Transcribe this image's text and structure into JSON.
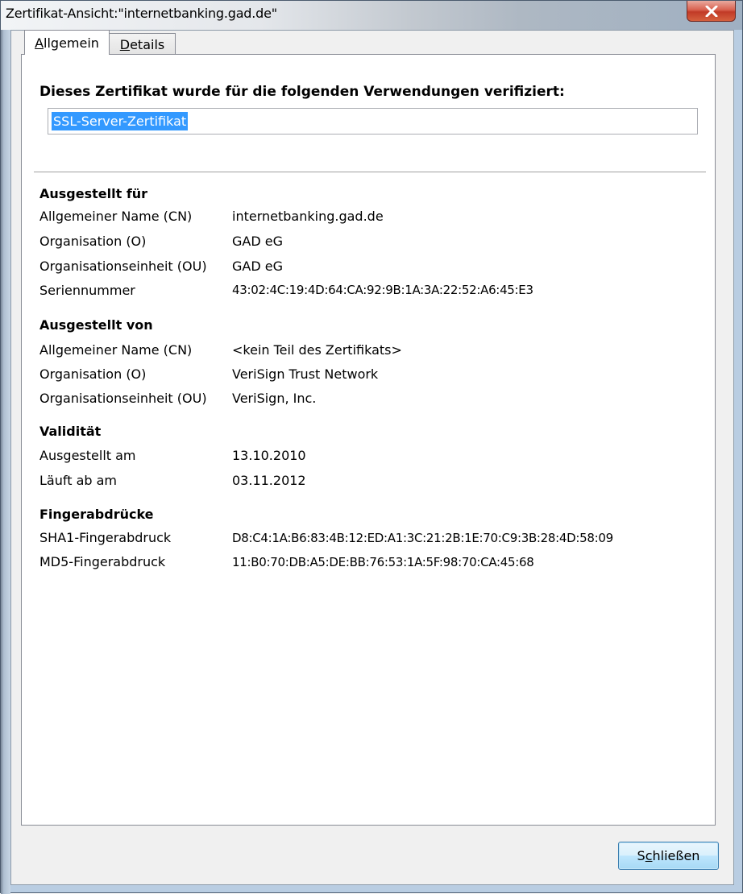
{
  "window": {
    "title": "Zertifikat-Ansicht:\"internetbanking.gad.de\""
  },
  "tabs": [
    {
      "accel": "A",
      "rest": "llgemein",
      "active": true
    },
    {
      "accel": "D",
      "rest": "etails",
      "active": false
    }
  ],
  "general": {
    "heading": "Dieses Zertifikat wurde für die folgenden Verwendungen verifiziert:",
    "usages": [
      "SSL-Server-Zertifikat"
    ]
  },
  "sections": {
    "issued_to": {
      "title": "Ausgestellt für",
      "rows": [
        {
          "label": "Allgemeiner Name (CN)",
          "value": "internetbanking.gad.de"
        },
        {
          "label": "Organisation (O)",
          "value": "GAD eG"
        },
        {
          "label": "Organisationseinheit (OU)",
          "value": "GAD eG"
        },
        {
          "label": "Seriennummer",
          "value": "43:02:4C:19:4D:64:CA:92:9B:1A:3A:22:52:A6:45:E3"
        }
      ]
    },
    "issued_by": {
      "title": "Ausgestellt von",
      "rows": [
        {
          "label": "Allgemeiner Name (CN)",
          "value": "<kein Teil des Zertifikats>"
        },
        {
          "label": "Organisation (O)",
          "value": "VeriSign Trust Network"
        },
        {
          "label": "Organisationseinheit (OU)",
          "value": "VeriSign, Inc."
        }
      ]
    },
    "validity": {
      "title": "Validität",
      "rows": [
        {
          "label": "Ausgestellt am",
          "value": "13.10.2010"
        },
        {
          "label": "Läuft ab am",
          "value": "03.11.2012"
        }
      ]
    },
    "fingerprints": {
      "title": "Fingerabdrücke",
      "rows": [
        {
          "label": "SHA1-Fingerabdruck",
          "value": "D8:C4:1A:B6:83:4B:12:ED:A1:3C:21:2B:1E:70:C9:3B:28:4D:58:09"
        },
        {
          "label": "MD5-Fingerabdruck",
          "value": "11:B0:70:DB:A5:DE:BB:76:53:1A:5F:98:70:CA:45:68"
        }
      ]
    }
  },
  "buttons": {
    "close": {
      "pre": "S",
      "accel": "c",
      "post": "hließen"
    }
  },
  "colors": {
    "selection": "#3399ff",
    "close_button": "#c13a27"
  }
}
